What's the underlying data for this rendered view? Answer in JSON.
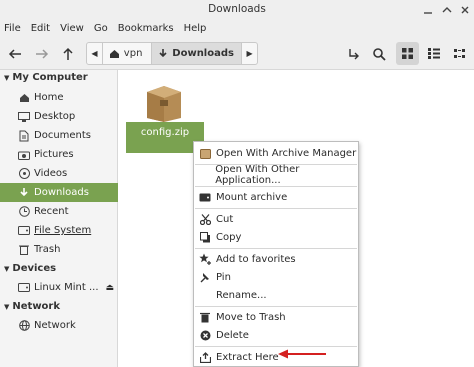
{
  "window": {
    "title": "Downloads"
  },
  "menu": [
    "File",
    "Edit",
    "View",
    "Go",
    "Bookmarks",
    "Help"
  ],
  "toolbar": {
    "breadcrumbs": [
      "vpn",
      "Downloads"
    ]
  },
  "sidebar": {
    "sections": [
      {
        "label": "My Computer",
        "items": [
          "Home",
          "Desktop",
          "Documents",
          "Pictures",
          "Videos",
          "Downloads",
          "Recent",
          "File System",
          "Trash"
        ]
      },
      {
        "label": "Devices",
        "items": [
          "Linux Mint ..."
        ]
      },
      {
        "label": "Network",
        "items": [
          "Network"
        ]
      }
    ],
    "active": "Downloads"
  },
  "file": {
    "name": "config.zip"
  },
  "context_menu": {
    "items": [
      {
        "label": "Open With Archive Manager",
        "icon": "archive-manager-icon"
      },
      {
        "label": "Open With Other Application...",
        "icon": ""
      },
      {
        "label": "Mount archive",
        "icon": "drive-icon"
      },
      {
        "label": "Cut",
        "icon": "scissors-icon"
      },
      {
        "label": "Copy",
        "icon": "copy-icon"
      },
      {
        "label": "Add to favorites",
        "icon": "star-add-icon"
      },
      {
        "label": "Pin",
        "icon": "pin-icon"
      },
      {
        "label": "Rename...",
        "icon": ""
      },
      {
        "label": "Move to Trash",
        "icon": "trash-icon"
      },
      {
        "label": "Delete",
        "icon": "delete-icon"
      },
      {
        "label": "Extract Here",
        "icon": "extract-icon"
      }
    ]
  },
  "colors": {
    "accent": "#7aa250",
    "annotation_arrow": "#d42020"
  }
}
